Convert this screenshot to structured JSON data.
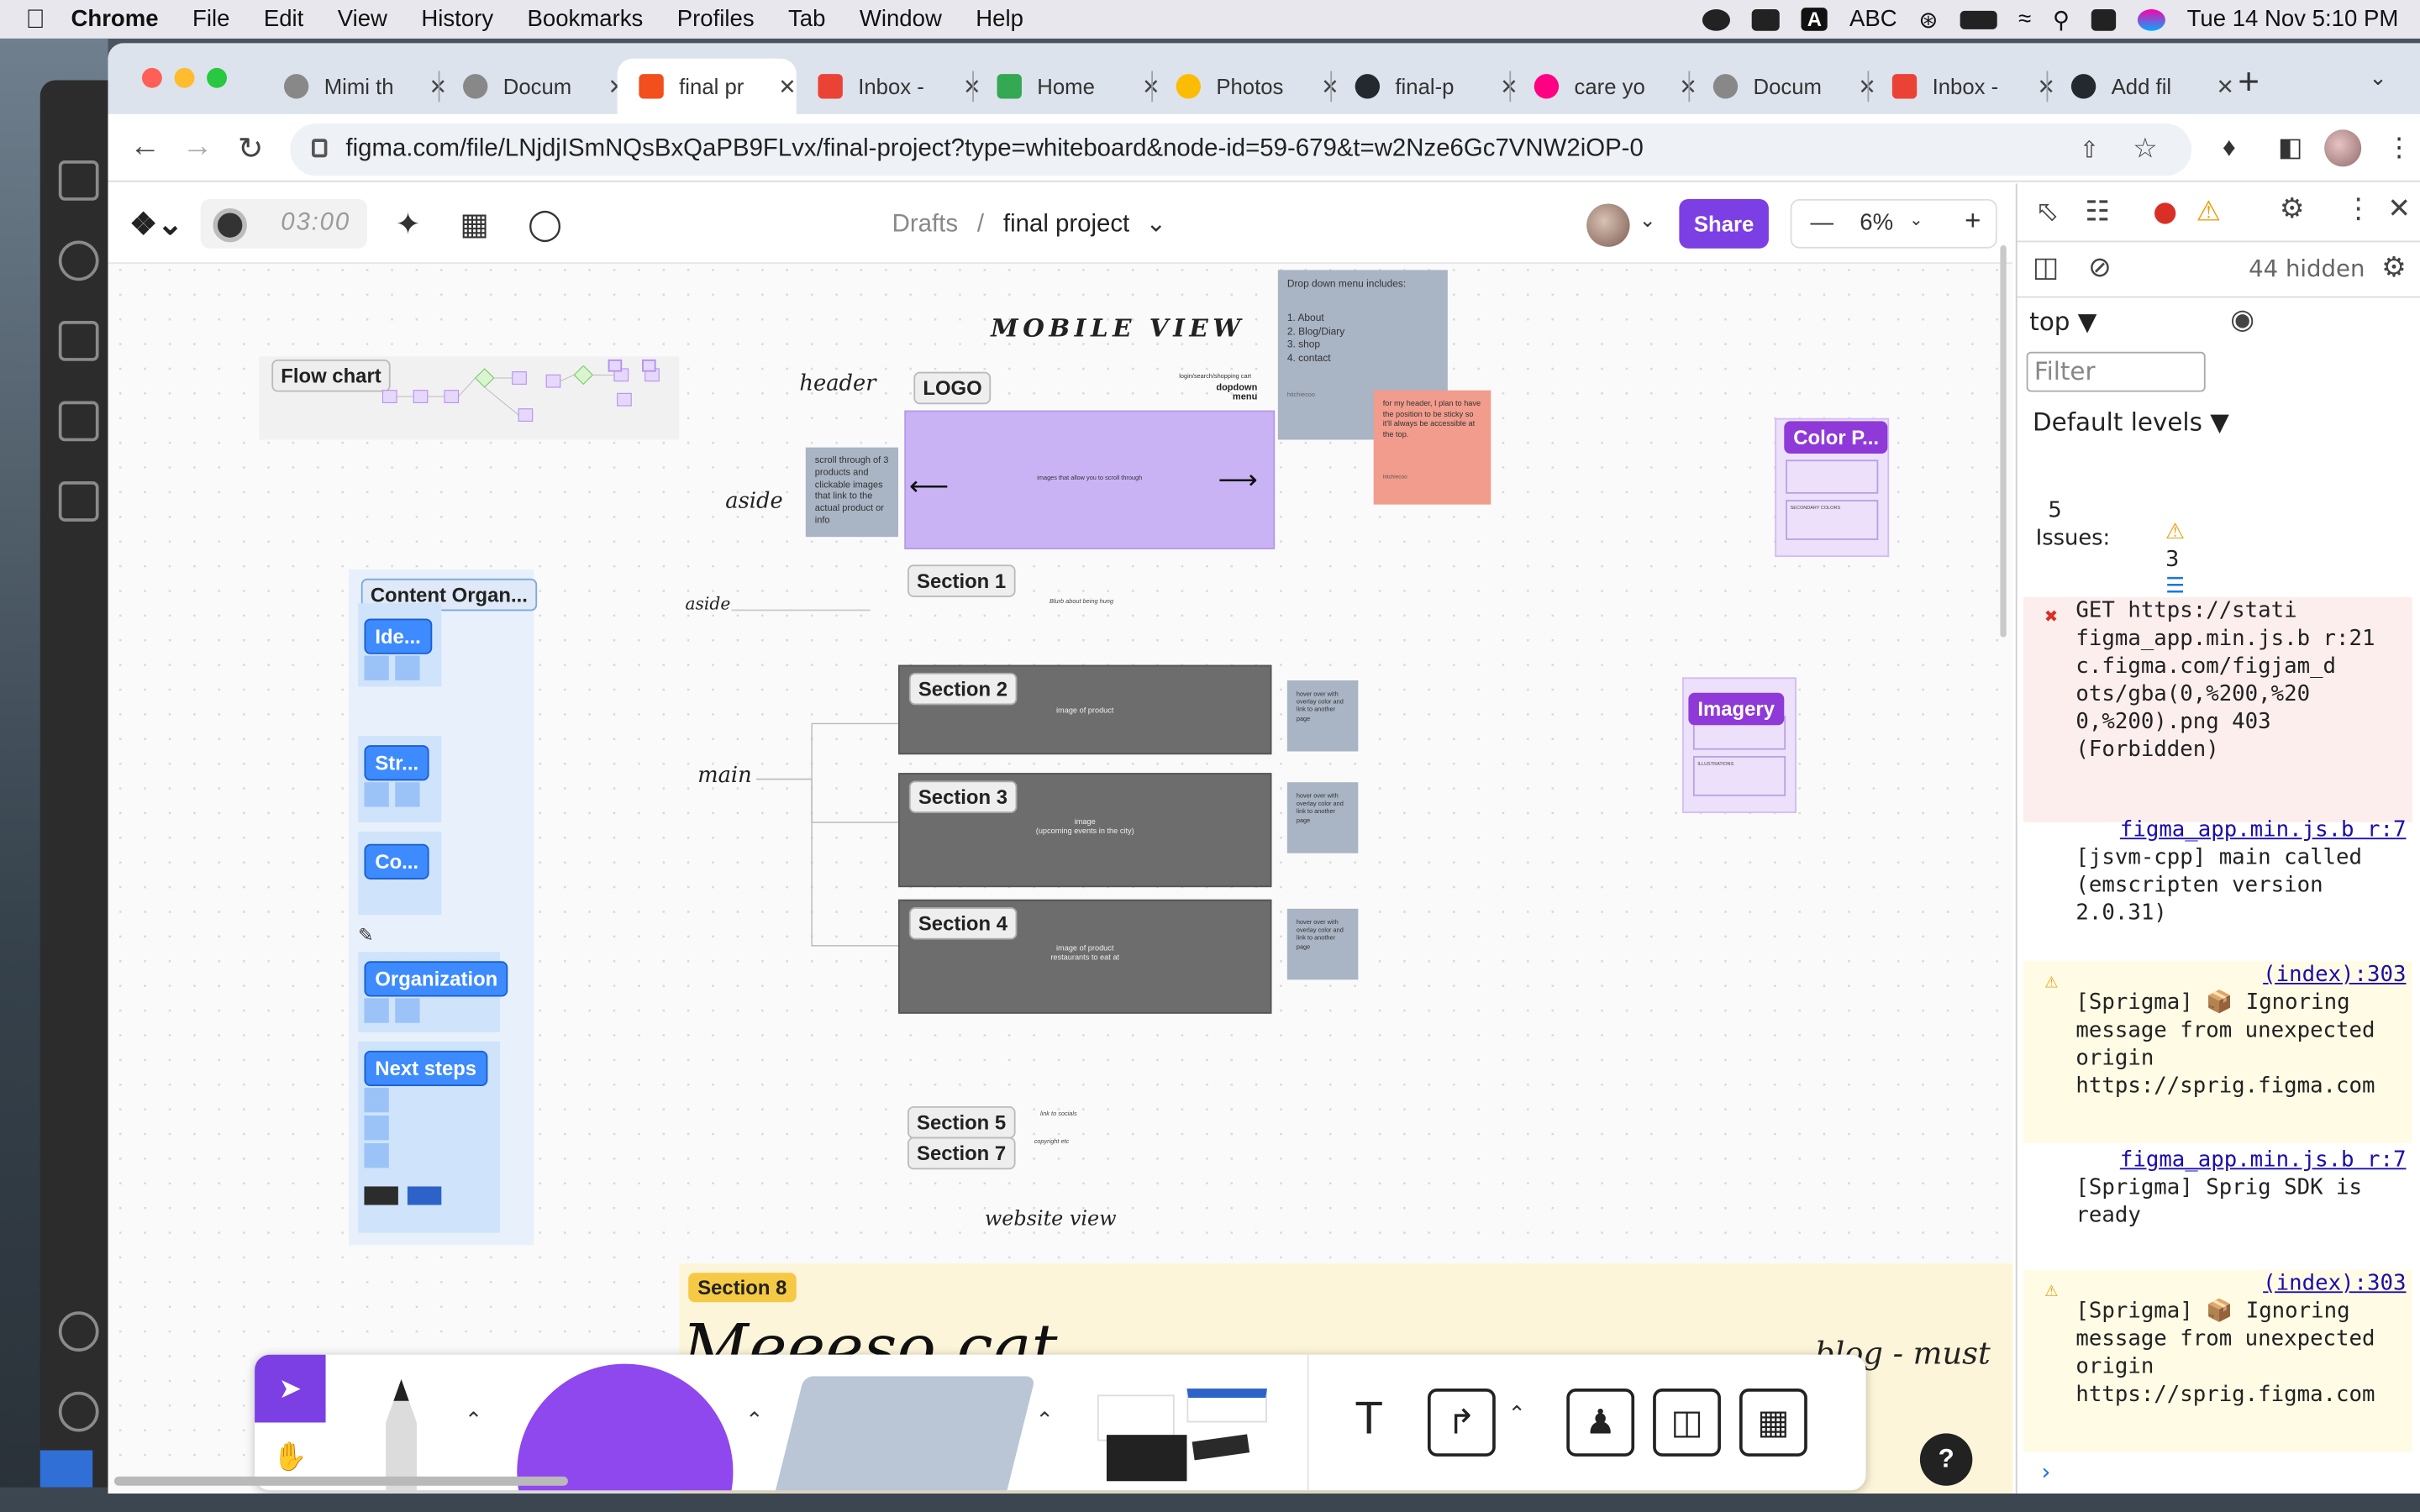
{
  "menubar": {
    "app": "Chrome",
    "items": [
      "File",
      "Edit",
      "View",
      "History",
      "Bookmarks",
      "Profiles",
      "Tab",
      "Window",
      "Help"
    ],
    "abc": "ABC",
    "datetime": "Tue 14 Nov  5:10 PM"
  },
  "tabs": [
    {
      "title": "Mimi th",
      "fav_color": "#888888"
    },
    {
      "title": "Docum",
      "fav_color": "#888888"
    },
    {
      "title": "final pr",
      "fav_color": "#f24e1e"
    },
    {
      "title": "Inbox -",
      "fav_color": "#ea4335"
    },
    {
      "title": "Home",
      "fav_color": "#34a853"
    },
    {
      "title": "Photos",
      "fav_color": "#fbbc04"
    },
    {
      "title": "final-p",
      "fav_color": "#24292f"
    },
    {
      "title": "care yo",
      "fav_color": "#ff0084"
    },
    {
      "title": "Docum",
      "fav_color": "#888888"
    },
    {
      "title": "Inbox -",
      "fav_color": "#ea4335"
    },
    {
      "title": "Add fil",
      "fav_color": "#24292f"
    }
  ],
  "url": "figma.com/file/LNjdjISmNQsBxQaPB9FLvx/final-project?type=whiteboard&node-id=59-679&t=w2Nze6Gc7VNW2iOP-0",
  "figma": {
    "timer": "03:00",
    "breadcrumb_parent": "Drafts",
    "breadcrumb_sep": "/",
    "file_name": "final project",
    "share": "Share",
    "zoom": "6%",
    "accent": "#7b3fe4"
  },
  "canvas": {
    "flow_chart": "Flow chart",
    "mobile_view": "MOBILE VIEW",
    "header": "header",
    "logo": "LOGO",
    "login_text": "login/search/shopping cart",
    "dropdown": "dopdown\nmenu",
    "aside1": "aside",
    "aside2": "aside",
    "main": "main",
    "scroll_note": "scroll through of 3 products and clickable images that link to the actual product or info",
    "carousel_text": "images that allow you to scroll through",
    "dropdown_note_title": "Drop down menu includes:",
    "dropdown_note_items": [
      "1. About",
      "2. Blog/Diary",
      "3. shop",
      "4. contact"
    ],
    "dropdown_note_author": "hitchiecoo",
    "header_note": "for my header, I plan to have the position to be sticky so it'll always be accessible at the top.",
    "header_note_author": "hitchiecoo",
    "section1": "Section 1",
    "section1_note": "Blurb about being hung",
    "section2": "Section 2",
    "section2_text": "image of product",
    "section3": "Section 3",
    "section3_text": "image\n(upcoming events in the city)",
    "section4": "Section 4",
    "section4_text": "image of product\nrestaurants to eat at",
    "hover_note": "hover over with overlay color and link to another page",
    "section5": "Section 5",
    "section5_note": "link to socials",
    "section7": "Section 7",
    "section7_note": "copyright etc",
    "website_view": "website view",
    "section8": "Section 8",
    "big_text": "Meeeso cat",
    "big_text_right": "blog - must",
    "content_org": "Content Organ...",
    "ideas": "Ide...",
    "str": "Str...",
    "co": "Co...",
    "organization": "Organization",
    "next_steps": "Next steps",
    "color_p": "Color P...",
    "secondary_colors": "SECONDARY COLORS",
    "imagery": "Imagery",
    "illustrations": "ILLUSTRATIONS"
  },
  "devtools": {
    "hidden": "44 hidden",
    "context": "top",
    "filter_placeholder": "Filter",
    "levels": "Default levels",
    "issues_count": "5",
    "issues_label": "Issues:",
    "issues_warn": "3",
    "messages": [
      {
        "type": "error",
        "text": "GET https://stati figma_app.min.js.b r:21 c.figma.com/figjam_d ots/gba(0,%200,%20 0,%200).png 403 (Forbidden)"
      },
      {
        "type": "info",
        "source": "figma_app.min.js.b r:7",
        "text": "[jsvm-cpp] main called (emscripten version 2.0.31)"
      },
      {
        "type": "warn",
        "source": "(index):303",
        "text": "[Sprigma] 📦 Ignoring message from unexpected origin https://sprig.figma.com"
      },
      {
        "type": "info",
        "source": "figma_app.min.js.b r:7",
        "text": "[Sprigma] Sprig SDK is ready"
      },
      {
        "type": "warn",
        "source": "(index):303",
        "text": "[Sprigma] 📦 Ignoring message from unexpected origin https://sprig.figma.com"
      }
    ]
  }
}
